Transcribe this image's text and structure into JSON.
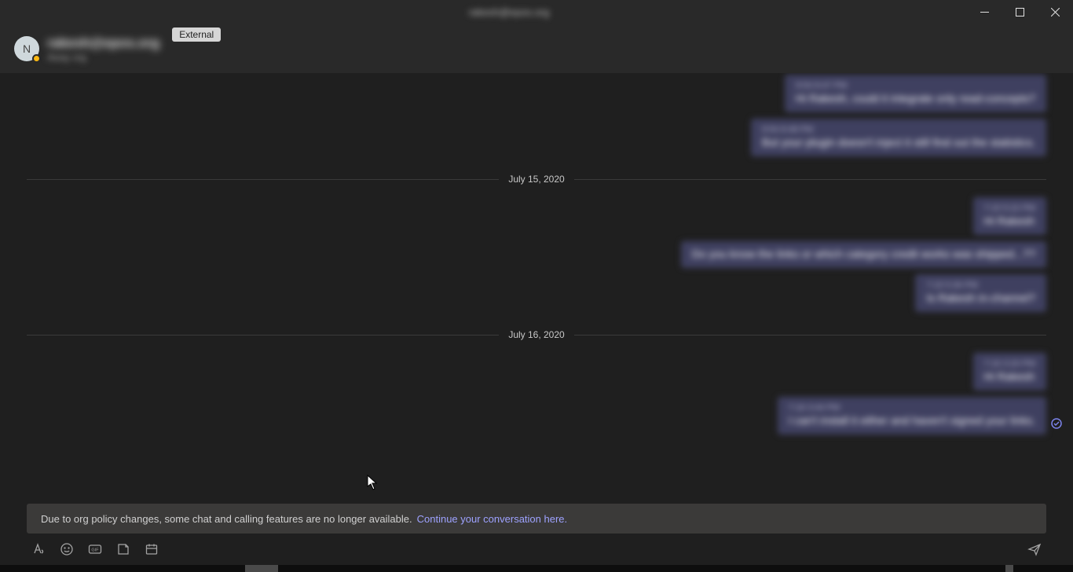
{
  "window": {
    "title": "rakesh@epos.org"
  },
  "header": {
    "avatar_initial": "N",
    "name": "rakesh@epos.org",
    "subtitle": "Away org",
    "external_label": "External"
  },
  "dates": {
    "d1": "July 15, 2020",
    "d2": "July 16, 2020"
  },
  "messages": {
    "m1": {
      "ts": "9:54 8:47 PM",
      "text": "Hi Rakesh, could it integrate only read-concepts?"
    },
    "m2": {
      "ts": "9:54 8:48 PM",
      "text": "But your plugin doesn't inject it still find out the statistics."
    },
    "m3": {
      "ts": "7:15 5:22 PM",
      "text": "Hi Rakesh"
    },
    "m4": {
      "ts": "",
      "text": "Do you know the links or which category credit works was shipped...??"
    },
    "m5": {
      "ts": "7:15 5:30 PM",
      "text": "Is Rakesh in-channel?"
    },
    "m6": {
      "ts": "7:16 3:20 PM",
      "text": "Hi Rakesh"
    },
    "m7": {
      "ts": "7:16 3:44 PM",
      "text": "I can't install it either and haven't signed your links."
    }
  },
  "compose": {
    "notice": "Due to org policy changes, some chat and calling features are no longer available.",
    "link": "Continue your conversation here."
  }
}
